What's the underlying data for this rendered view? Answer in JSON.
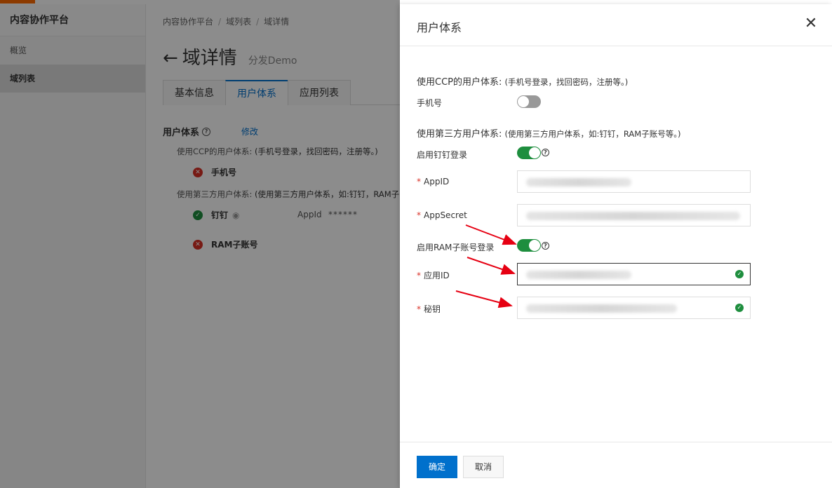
{
  "sidebar": {
    "title": "内容协作平台",
    "items": [
      {
        "label": "概览"
      },
      {
        "label": "域列表"
      }
    ]
  },
  "main": {
    "breadcrumb": [
      "内容协作平台",
      "域列表",
      "域详情"
    ],
    "title": "域详情",
    "subtitle": "分发Demo",
    "tabs": [
      "基本信息",
      "用户体系",
      "应用列表"
    ],
    "section_title": "用户体系",
    "edit_label": "修改",
    "ccp_desc_title": "使用CCP的用户体系:",
    "ccp_desc_note": "(手机号登录，找回密码，注册等。)",
    "phone_label": "手机号",
    "third_desc_title": "使用第三方用户体系:",
    "third_desc_note": "(使用第三方用户体系，如:钉钉，RAM子",
    "dingtalk_label": "钉钉",
    "appid_key": "AppId",
    "appid_masked": "******",
    "ram_label": "RAM子账号"
  },
  "drawer": {
    "title": "用户体系",
    "ccp_title": "使用CCP的用户体系:",
    "ccp_note": "(手机号登录，找回密码，注册等。)",
    "phone_toggle_label": "手机号",
    "phone_enabled": false,
    "third_title": "使用第三方用户体系:",
    "third_note": "(使用第三方用户体系，如:钉钉，RAM子账号等。)",
    "dingtalk_toggle_label": "启用钉钉登录",
    "dingtalk_enabled": true,
    "appid_label": "AppID",
    "appsecret_label": "AppSecret",
    "ram_toggle_label": "启用RAM子账号登录",
    "ram_enabled": true,
    "app_id_label": "应用ID",
    "secret_label": "秘钥",
    "help_glyph": "?",
    "confirm_label": "确定",
    "cancel_label": "取消"
  },
  "colors": {
    "brand": "#ff6a00",
    "primary": "#0070cc",
    "switch_on": "#1e8e3e",
    "required": "#d93026",
    "arrow": "#e60012"
  }
}
